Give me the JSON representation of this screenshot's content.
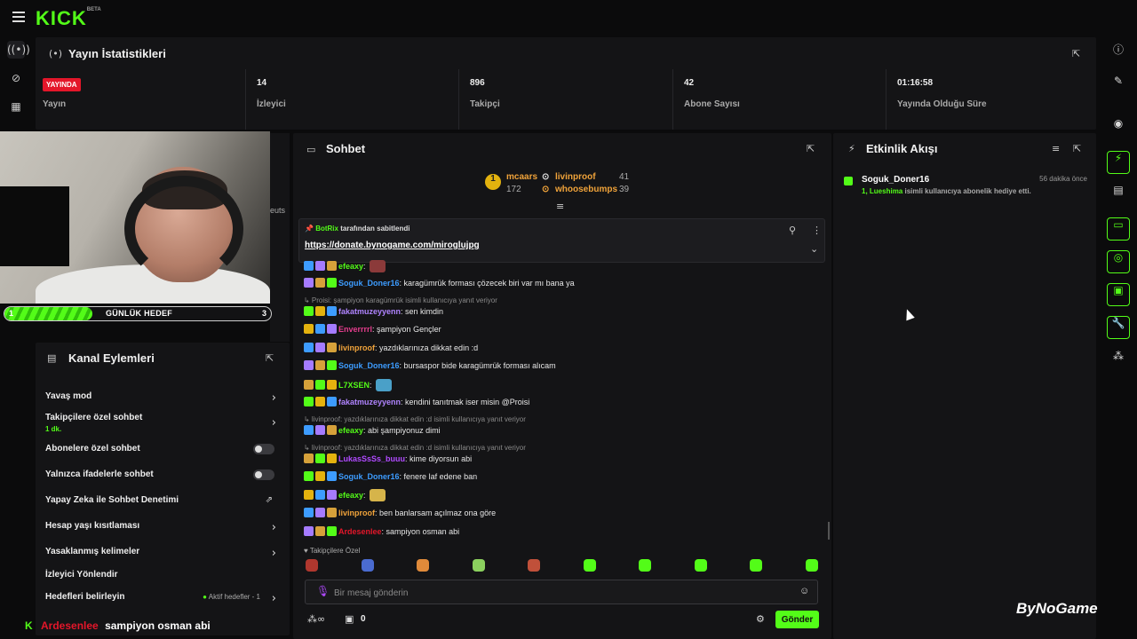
{
  "brand": {
    "logo": "KICK",
    "beta": "BETA",
    "accent": "#53fc18"
  },
  "left_rail": {
    "icons": [
      "broadcast-icon",
      "link-icon",
      "chart-icon"
    ]
  },
  "stats": {
    "title": "Yayın İstatistikleri",
    "cells": [
      {
        "value": "YAYINDA",
        "label": "Yayın"
      },
      {
        "value": "14",
        "label": "İzleyici"
      },
      {
        "value": "896",
        "label": "Takipçi"
      },
      {
        "value": "42",
        "label": "Abone Sayısı"
      },
      {
        "value": "01:16:58",
        "label": "Yayında Olduğu Süre"
      }
    ]
  },
  "goal": {
    "start": "1",
    "label": "GÜNLÜK HEDEF",
    "end": "3",
    "progress": 0.33
  },
  "cut_text": "euts",
  "actions": {
    "title": "Kanal Eylemleri",
    "rows": [
      {
        "label": "Yavaş mod",
        "kind": "chevron"
      },
      {
        "label": "Takipçilere özel sohbet",
        "sub": "1 dk.",
        "kind": "chevron"
      },
      {
        "label": "Abonelere özel sohbet",
        "kind": "toggle"
      },
      {
        "label": "Yalnızca ifadelerle sohbet",
        "kind": "toggle"
      },
      {
        "label": "Yapay Zeka ile Sohbet Denetimi",
        "kind": "external"
      },
      {
        "label": "Hesap yaşı kısıtlaması",
        "kind": "chevron"
      },
      {
        "label": "Yasaklanmış kelimeler",
        "kind": "chevron"
      },
      {
        "label": "İzleyici Yönlendir",
        "kind": "none"
      },
      {
        "label": "Hedefleri belirleyin",
        "kind": "chevron",
        "note_prefix": "Aktif hedefler - ",
        "note_count": "1"
      }
    ]
  },
  "bottom_message": {
    "user": "Ardesenlee",
    "text": "sampiyon osman abi",
    "user_color": "#e4162a"
  },
  "chat": {
    "title": "Sohbet",
    "leaderboard": [
      {
        "rank": "1",
        "name": "mcaars",
        "count": "172"
      },
      {
        "name": "livinproof",
        "count": "41"
      },
      {
        "name": "whoosebumps",
        "count": "39"
      }
    ],
    "pinned": {
      "by_user": "BotRix",
      "by_suffix": "tarafından sabitlendi",
      "link": "https://donate.bynogame.com/miroglujpg"
    },
    "messages": [
      {
        "user": "efeaxy",
        "text": "",
        "color": "#53fc18",
        "emote": "#8b3a3a"
      },
      {
        "user": "Soguk_Doner16",
        "text": "karagümrük forması çözecek biri var mı bana ya",
        "color": "#3d9cff"
      },
      {
        "reply": "Proisi: şampiyon karagümrük isimli kullanıcıya yanıt veriyor"
      },
      {
        "user": "fakatmuzeyyenn",
        "text": "sen kimdin",
        "color": "#b084ff"
      },
      {
        "user": "Enverrrrl",
        "text": "şampiyon Gençler",
        "color": "#e43d8d"
      },
      {
        "user": "livinproof",
        "text": "yazdıklarınıza dikkat edin :d",
        "color": "#f0a33a"
      },
      {
        "user": "Soguk_Doner16",
        "text": "bursaspor bide karagümrük forması alıcam",
        "color": "#3d9cff"
      },
      {
        "user": "L7XSEN",
        "text": "",
        "color": "#53fc18",
        "emote": "#4aa0c8"
      },
      {
        "user": "fakatmuzeyyenn",
        "text": "kendini tanıtmak iser misin @Proisi",
        "color": "#b084ff"
      },
      {
        "reply": "livinproof: yazdıklarınıza dikkat edin :d isimli kullanıcıya yanıt veriyor"
      },
      {
        "user": "efeaxy",
        "text": "abi şampiyonuz dimi",
        "color": "#53fc18"
      },
      {
        "reply": "livinproof: yazdıklarınıza dikkat edin :d isimli kullanıcıya yanıt veriyor"
      },
      {
        "user": "LukasSsSs_buuu",
        "text": "kime diyorsun abi",
        "color": "#b04aff"
      },
      {
        "user": "Soguk_Doner16",
        "text": "fenere laf edene ban",
        "color": "#3d9cff"
      },
      {
        "user": "efeaxy",
        "text": "",
        "color": "#53fc18",
        "emote": "#d6b44a"
      },
      {
        "user": "livinproof",
        "text": "ben banlarsam açılmaz ona göre",
        "color": "#f0a33a"
      },
      {
        "user": "Ardesenlee",
        "text": "sampiyon osman abi",
        "color": "#e4162a"
      }
    ],
    "subs_label": "Takipçilere Özel",
    "input_placeholder": "Bir mesaj gönderin",
    "points": "0",
    "send_label": "Gönder"
  },
  "activity": {
    "title": "Etkinlik Akışı",
    "items": [
      {
        "user": "Soguk_Doner16",
        "time": "56 dakika önce",
        "count": "1",
        "recipient": "Lueshima",
        "text": "isimli kullanıcıya abonelik hediye etti."
      }
    ]
  },
  "watermark": "ByNoGame"
}
